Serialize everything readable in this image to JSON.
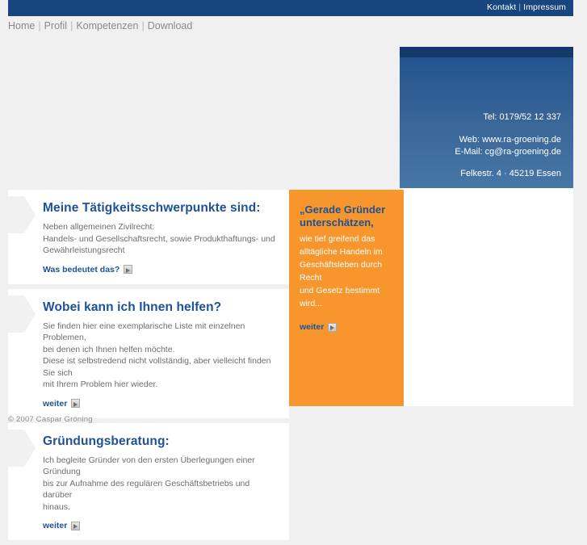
{
  "topbar": {
    "links": [
      {
        "label": "Kontakt"
      },
      {
        "label": "Impressum"
      }
    ],
    "separator": "|",
    "background_color": "#19457f"
  },
  "mainnav": {
    "separator": "|",
    "items": [
      {
        "label": "Home"
      },
      {
        "label": "Profil"
      },
      {
        "label": "Kompetenzen"
      },
      {
        "label": "Download"
      }
    ]
  },
  "contact": {
    "phone": "Tel: 0179/52 12 337",
    "web": "Web: www.ra-groening.de",
    "email": "E-Mail: cg@ra-groening.de",
    "address": "Felkestr. 4 · 45219 Essen",
    "gradient_top_color": "#1b457d",
    "gradient_bottom_color": "#4677a6"
  },
  "cards": [
    {
      "title": "Meine Tätigkeitsschwerpunkte sind:",
      "body": "Neben allgemeinen Zivilrecht:\nHandels- und Gesellschaftsrecht, sowie Produkthaftungs- und\nGewährleistungsrecht",
      "more_label": "Was bedeutet das?",
      "more_icon": "arrow-right-icon"
    },
    {
      "title": "Wobei kann ich Ihnen helfen?",
      "body": "Sie finden hier eine exemplarische Liste mit einzelnen Problemen,\nbei denen ich Ihnen helfen möchte.\nDiese ist selbstredend nicht vollständig, aber vielleicht finden Sie sich\nmit Ihrem Problem hier wieder.",
      "more_label": "weiter",
      "more_icon": "arrow-right-icon"
    },
    {
      "title": "Gründungsberatung:",
      "body": "Ich begleite Gründer von den ersten Überlegungen einer Gründung\nbis zur Aufnahme des regulären Geschäftsbetriebs und darüber\nhinaus.",
      "more_label": "weiter",
      "more_icon": "arrow-right-icon"
    }
  ],
  "quote": {
    "headline": "„Gerade Gründer\nunterschätzen,",
    "body": "wie tief greifend das\nalltägliche Handeln im\nGeschäftsleben durch Recht\nund Gesetz bestimmt\nwird...",
    "more_label": "weiter",
    "more_icon": "arrow-right-icon",
    "background_color": "#f7962d",
    "headline_color": "#1e5196"
  },
  "footer": {
    "copyright": "© 2007 Caspar Gröning"
  }
}
